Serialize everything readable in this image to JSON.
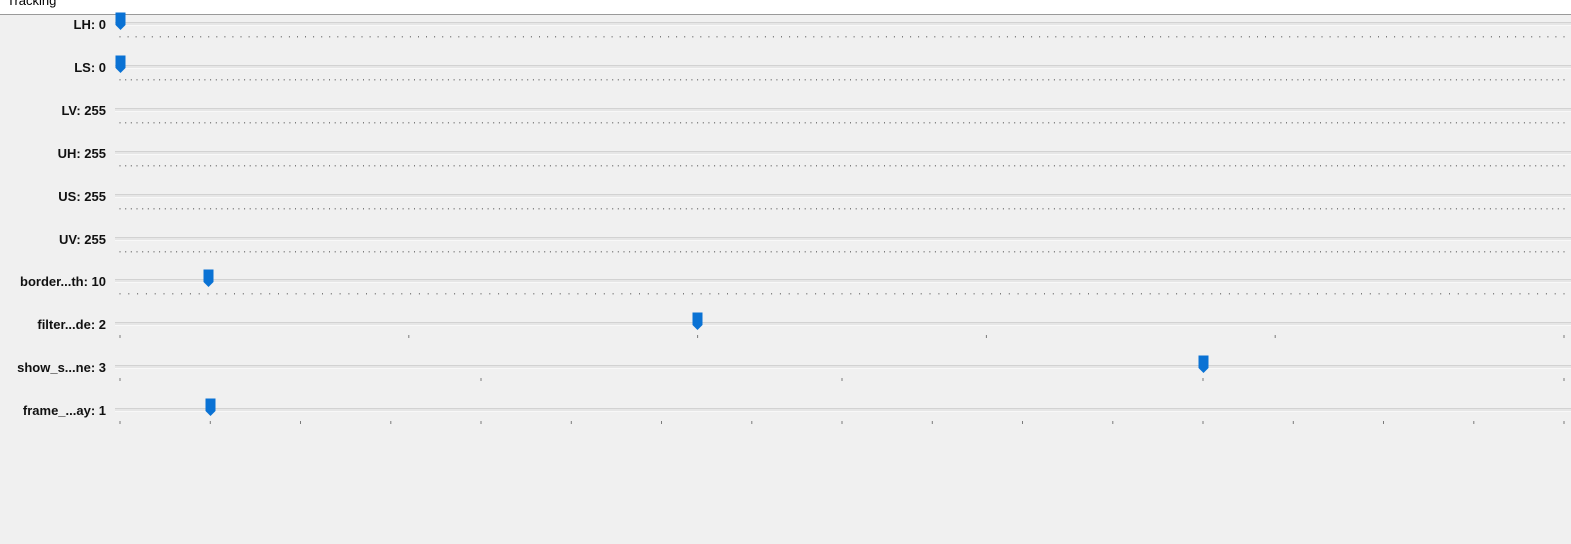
{
  "window": {
    "title": "Tracking"
  },
  "colors": {
    "thumb": "#0a72d4",
    "tick": "#7a7a7a",
    "track": "#e6e6e6"
  },
  "sliders": [
    {
      "label": "LH: 0",
      "value": 0,
      "max": 179,
      "show_thumb": true
    },
    {
      "label": "LS: 0",
      "value": 0,
      "max": 255,
      "show_thumb": true
    },
    {
      "label": "LV: 255",
      "value": 255,
      "max": 255,
      "show_thumb": false
    },
    {
      "label": "UH: 255",
      "value": 255,
      "max": 255,
      "show_thumb": false
    },
    {
      "label": "US: 255",
      "value": 255,
      "max": 255,
      "show_thumb": false
    },
    {
      "label": "UV: 255",
      "value": 255,
      "max": 255,
      "show_thumb": false
    },
    {
      "label": "border...th: 10",
      "value": 10,
      "max": 164,
      "show_thumb": true
    },
    {
      "label": "filter...de: 2",
      "value": 2,
      "max": 5,
      "show_thumb": true
    },
    {
      "label": "show_s...ne: 3",
      "value": 3,
      "max": 4,
      "show_thumb": true
    },
    {
      "label": "frame_...ay: 1",
      "value": 1,
      "max": 16,
      "show_thumb": true
    }
  ]
}
